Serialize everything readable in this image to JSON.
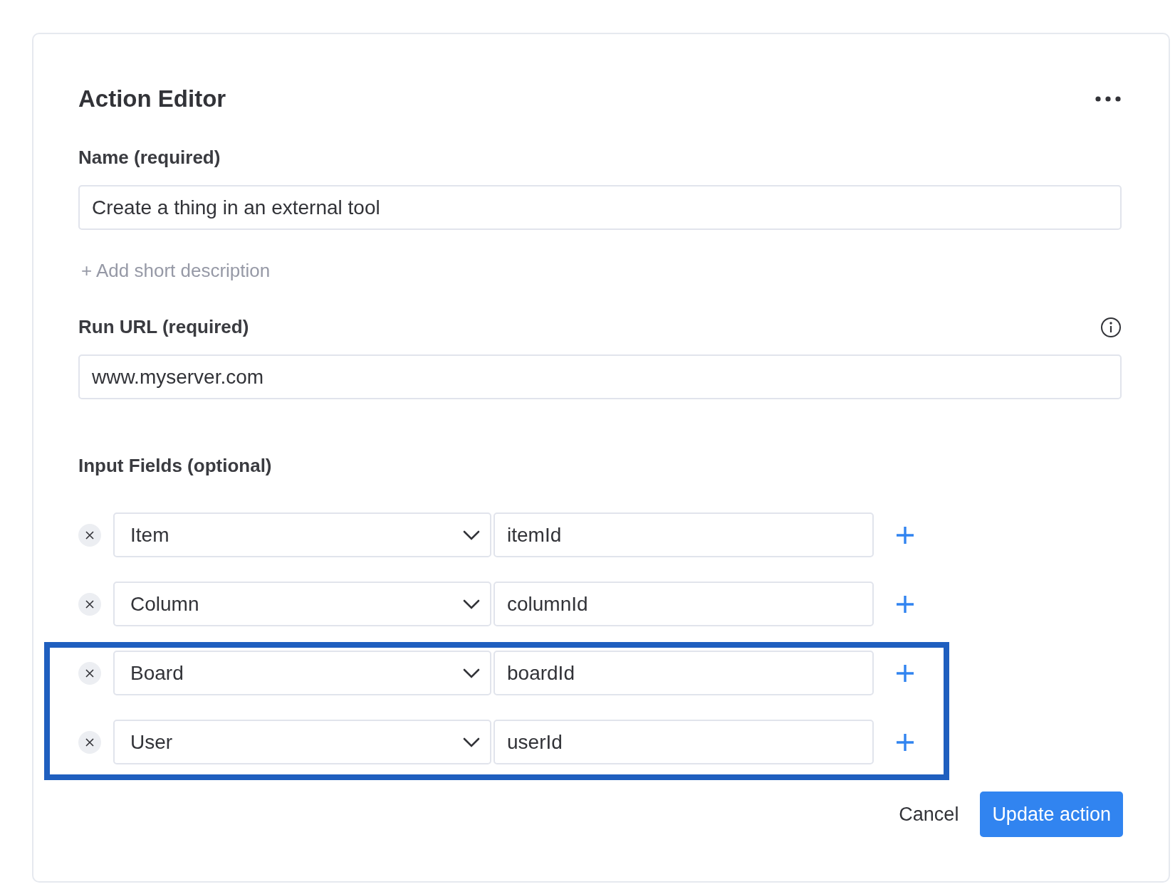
{
  "title": "Action Editor",
  "name_field": {
    "label": "Name (required)",
    "value": "Create a thing in an external tool"
  },
  "add_description": "+ Add short description",
  "url_field": {
    "label": "Run URL (required)",
    "value": "www.myserver.com"
  },
  "input_fields": {
    "label": "Input Fields (optional)",
    "rows": [
      {
        "type": "Item",
        "key": "itemId",
        "highlighted": false
      },
      {
        "type": "Column",
        "key": "columnId",
        "highlighted": false
      },
      {
        "type": "Board",
        "key": "boardId",
        "highlighted": true
      },
      {
        "type": "User",
        "key": "userId",
        "highlighted": true
      }
    ]
  },
  "buttons": {
    "cancel": "Cancel",
    "submit": "Update action"
  }
}
